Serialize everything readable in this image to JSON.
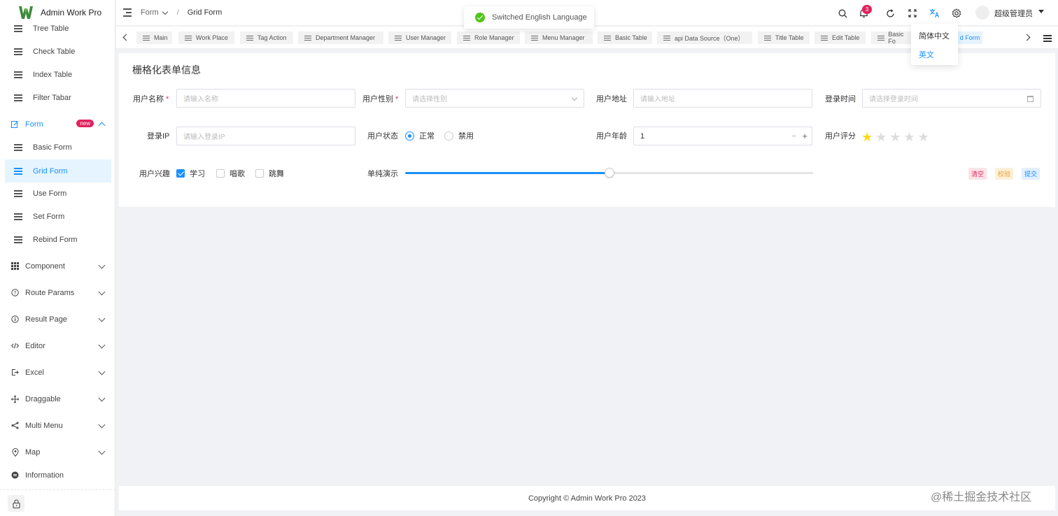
{
  "app": {
    "name": "Admin Work Pro"
  },
  "sidebar": {
    "items": [
      {
        "label": "Tree Table"
      },
      {
        "label": "Check Table"
      },
      {
        "label": "Index Table"
      },
      {
        "label": "Filter Tabar"
      },
      {
        "label": "Form",
        "badge": "new"
      },
      {
        "label": "Basic Form"
      },
      {
        "label": "Grid Form"
      },
      {
        "label": "Use Form"
      },
      {
        "label": "Set Form"
      },
      {
        "label": "Rebind Form"
      },
      {
        "label": "Component"
      },
      {
        "label": "Route Params"
      },
      {
        "label": "Result Page"
      },
      {
        "label": "Editor"
      },
      {
        "label": "Excel"
      },
      {
        "label": "Draggable"
      },
      {
        "label": "Multi Menu"
      },
      {
        "label": "Map"
      },
      {
        "label": "Information"
      }
    ]
  },
  "header": {
    "breadcrumb": {
      "parent": "Form",
      "current": "Grid Form"
    },
    "notification_count": "3",
    "user_name": "超级管理员"
  },
  "tabs": [
    {
      "label": "Main"
    },
    {
      "label": "Work Place"
    },
    {
      "label": "Tag Action"
    },
    {
      "label": "Department Manager"
    },
    {
      "label": "User Manager"
    },
    {
      "label": "Role Manager"
    },
    {
      "label": "Menu Manager"
    },
    {
      "label": "Basic Table"
    },
    {
      "label": "api Data Source（One）"
    },
    {
      "label": "Title Table"
    },
    {
      "label": "Edit Table"
    },
    {
      "label": "Basic Fo"
    },
    {
      "label": "d Form"
    }
  ],
  "toast": {
    "message": "Switched English Language"
  },
  "language_menu": {
    "options": [
      "简体中文",
      "英文"
    ],
    "selected": "英文"
  },
  "form": {
    "title": "栅格化表单信息",
    "username": {
      "label": "用户名称",
      "placeholder": "请输入名称"
    },
    "gender": {
      "label": "用户性别",
      "placeholder": "请选择性别"
    },
    "address": {
      "label": "用户地址",
      "placeholder": "请输入地址"
    },
    "login_time": {
      "label": "登录时间",
      "placeholder": "请选择登录时间"
    },
    "login_ip": {
      "label": "登录IP",
      "placeholder": "请输入登录IP"
    },
    "status": {
      "label": "用户状态",
      "options": [
        "正常",
        "禁用"
      ],
      "selected": "正常"
    },
    "age": {
      "label": "用户年龄",
      "value": "1"
    },
    "rating": {
      "label": "用户评分",
      "value": 1,
      "max": 5
    },
    "hobbies": {
      "label": "用户兴趣",
      "options": [
        "学习",
        "唱歌",
        "跳舞"
      ],
      "checked": [
        "学习"
      ]
    },
    "slider": {
      "label": "单纯演示",
      "value_fraction": 0.5
    },
    "buttons": {
      "clear": "清空",
      "validate": "校验",
      "submit": "提交"
    }
  },
  "footer": {
    "copyright": "Copyright © Admin Work Pro 2023"
  },
  "watermark": "@稀土掘金技术社区",
  "colors": {
    "primary": "#1890ff",
    "danger": "#e0245e",
    "success": "#52c41a",
    "warning": "#e6a23c"
  }
}
